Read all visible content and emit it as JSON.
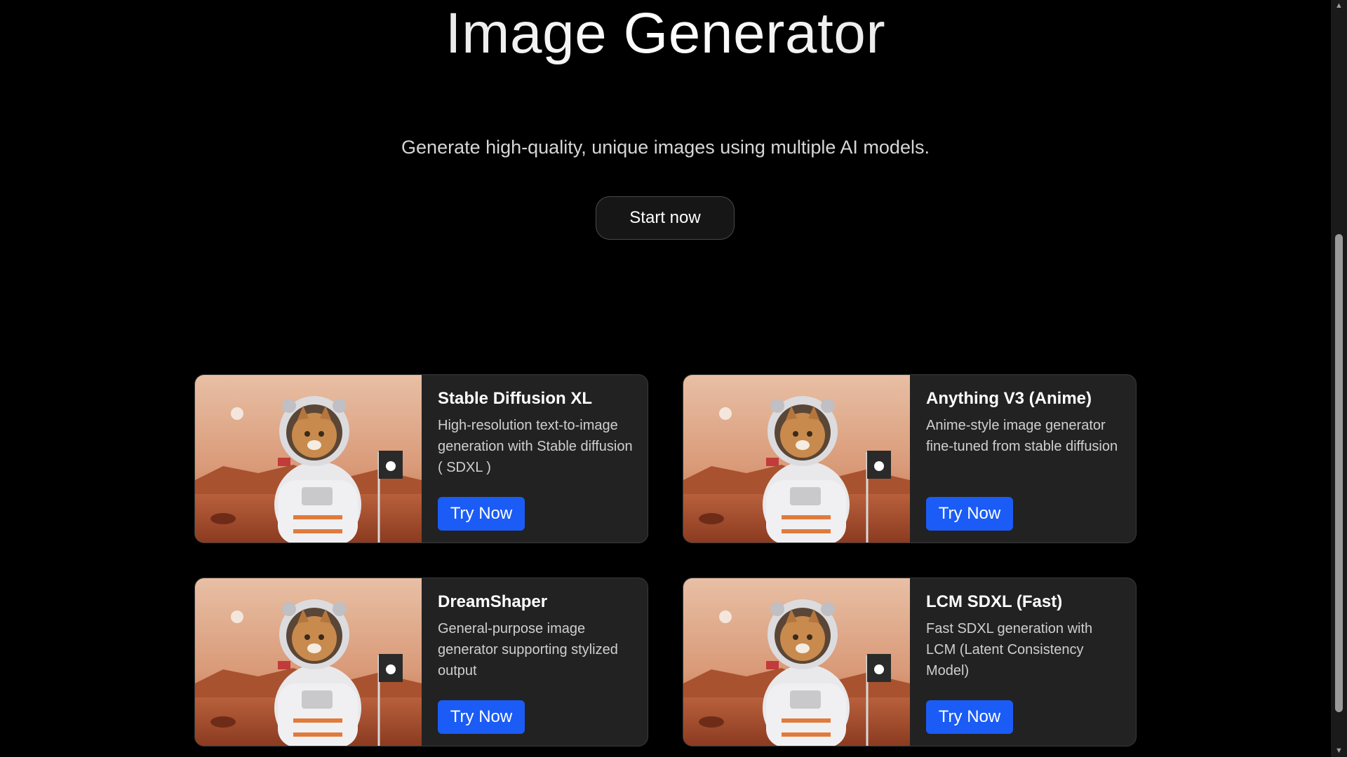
{
  "hero": {
    "title": "Image Generator",
    "subtitle": "Generate high-quality, unique images using multiple AI models.",
    "cta_label": "Start now"
  },
  "models": [
    {
      "title": "Stable Diffusion XL",
      "description": "High-resolution text-to-image generation with Stable diffusion ( SDXL )",
      "button_label": "Try Now",
      "image": "astronaut-cat-on-mars"
    },
    {
      "title": "Anything V3 (Anime)",
      "description": "Anime-style image generator fine-tuned from stable diffusion",
      "button_label": "Try Now",
      "image": "astronaut-cat-on-mars"
    },
    {
      "title": "DreamShaper",
      "description": "General-purpose image generator supporting stylized output",
      "button_label": "Try Now",
      "image": "astronaut-cat-on-mars"
    },
    {
      "title": "LCM SDXL (Fast)",
      "description": "Fast SDXL generation with LCM (Latent Consistency Model)",
      "button_label": "Try Now",
      "image": "astronaut-cat-on-mars"
    }
  ],
  "colors": {
    "background": "#000000",
    "card": "#222222",
    "accent_button": "#1a5cf5"
  }
}
